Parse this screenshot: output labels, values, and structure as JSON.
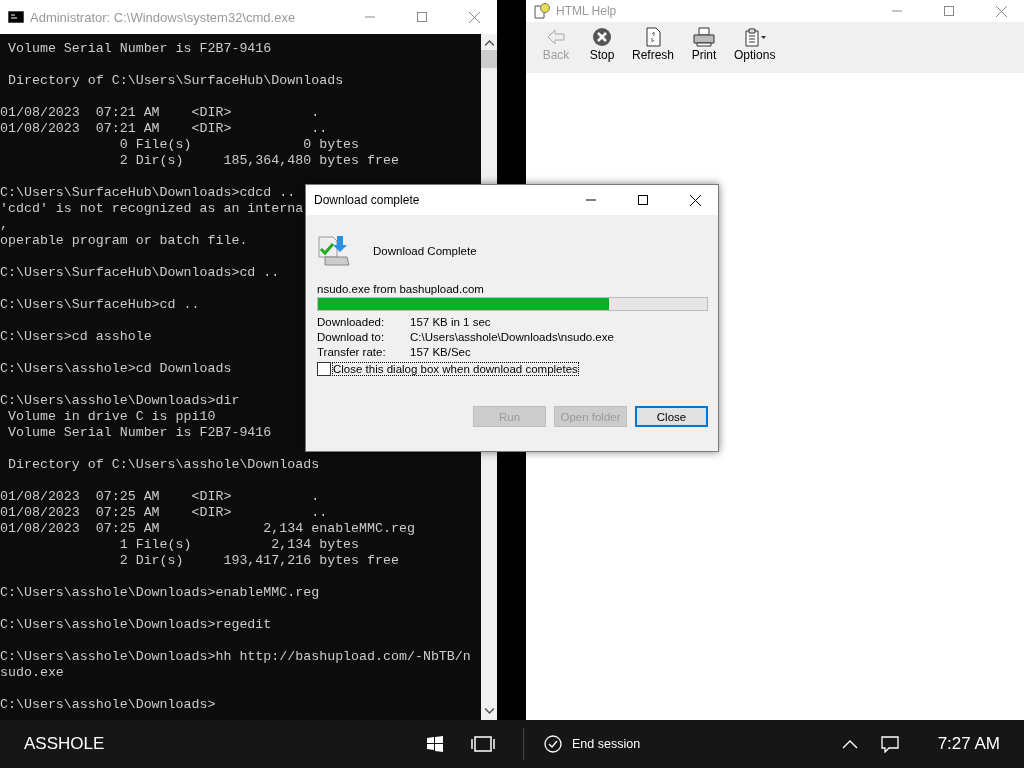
{
  "console_window": {
    "title": "Administrator: C:\\Windows\\system32\\cmd.exe",
    "active": false,
    "blocks": [
      {
        "lines": [
          " Volume Serial Number is F2B7-9416"
        ]
      },
      {
        "lines": [
          " Directory of C:\\Users\\SurfaceHub\\Downloads"
        ]
      },
      {
        "lines": [
          "01/08/2023  07:21 AM    <DIR>          .",
          "01/08/2023  07:21 AM    <DIR>          ..",
          "               0 File(s)              0 bytes",
          "               2 Dir(s)     185,364,480 bytes free"
        ]
      },
      {
        "lines": [
          "C:\\Users\\SurfaceHub\\Downloads>cdcd ..",
          "'cdcd' is not recognized as an interna",
          ",",
          "operable program or batch file."
        ]
      },
      {
        "lines": [
          "C:\\Users\\SurfaceHub\\Downloads>cd .."
        ]
      },
      {
        "lines": [
          "C:\\Users\\SurfaceHub>cd .."
        ]
      },
      {
        "lines": [
          "C:\\Users>cd asshole"
        ]
      },
      {
        "lines": [
          "C:\\Users\\asshole>cd Downloads"
        ]
      },
      {
        "lines": [
          "C:\\Users\\asshole\\Downloads>dir",
          " Volume in drive C is ppi10",
          " Volume Serial Number is F2B7-9416"
        ]
      },
      {
        "lines": [
          " Directory of C:\\Users\\asshole\\Downloads"
        ]
      },
      {
        "lines": [
          "01/08/2023  07:25 AM    <DIR>          .",
          "01/08/2023  07:25 AM    <DIR>          ..",
          "01/08/2023  07:25 AM             2,134 enableMMC.reg",
          "               1 File(s)          2,134 bytes",
          "               2 Dir(s)     193,417,216 bytes free"
        ]
      },
      {
        "lines": [
          "C:\\Users\\asshole\\Downloads>enableMMC.reg"
        ]
      },
      {
        "lines": [
          "C:\\Users\\asshole\\Downloads>regedit"
        ]
      },
      {
        "lines": [
          "C:\\Users\\asshole\\Downloads>hh http://bashupload.com/-NbTB/n",
          "sudo.exe"
        ]
      },
      {
        "lines": [
          "C:\\Users\\asshole\\Downloads>"
        ]
      }
    ]
  },
  "help_window": {
    "title": "HTML Help",
    "active": false,
    "toolbar": [
      {
        "kind": "back",
        "label": "Back",
        "disabled": true
      },
      {
        "kind": "stop",
        "label": "Stop",
        "disabled": false
      },
      {
        "kind": "refresh",
        "label": "Refresh",
        "disabled": false
      },
      {
        "kind": "print",
        "label": "Print",
        "disabled": false
      },
      {
        "kind": "options",
        "label": "Options",
        "disabled": false
      }
    ]
  },
  "dialog": {
    "title": "Download complete",
    "heading": "Download Complete",
    "source": "nsudo.exe from bashupload.com",
    "level": 0.747,
    "details": [
      {
        "label": "Downloaded:",
        "value": "157 KB in 1 sec"
      },
      {
        "label": "Download to:",
        "value": "C:\\Users\\asshole\\Downloads\\nsudo.exe"
      },
      {
        "label": "Transfer rate:",
        "value": "157 KB/Sec"
      }
    ],
    "close_when_done": {
      "label": "Close this dialog box when download completes",
      "checked": false
    },
    "buttons": [
      {
        "label": "Run",
        "disabled": true,
        "default": false
      },
      {
        "label": "Open folder",
        "disabled": true,
        "default": false
      },
      {
        "label": "Close",
        "disabled": false,
        "default": true
      }
    ]
  },
  "taskbar": {
    "user": "ASSHOLE",
    "end_session": "End session",
    "clock": "7:27 AM"
  }
}
